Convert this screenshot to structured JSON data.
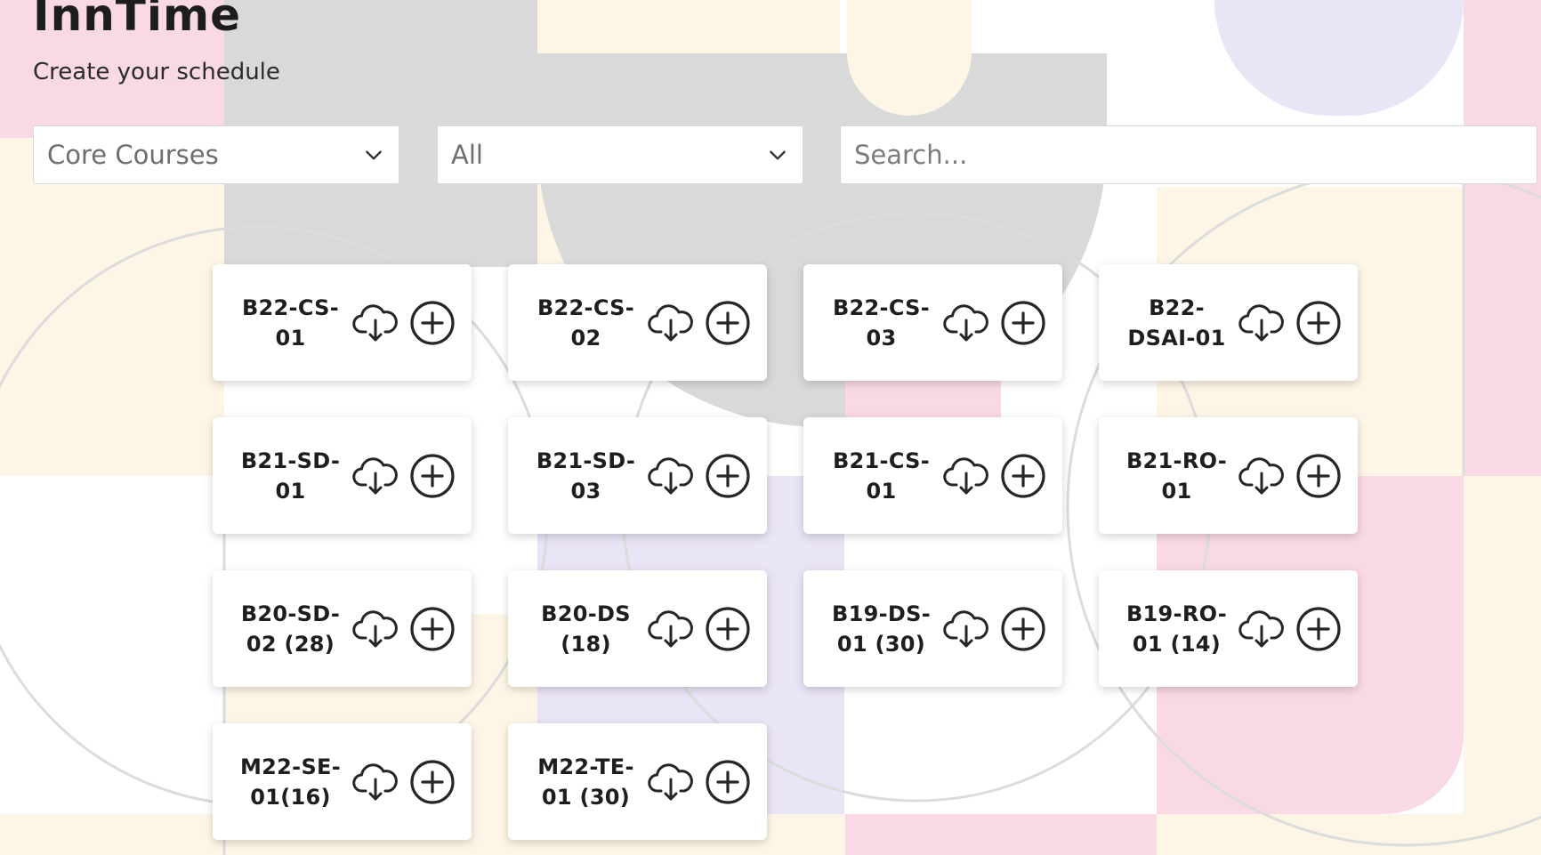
{
  "app": {
    "title": "InnTime",
    "subtitle": "Create your schedule"
  },
  "filters": {
    "category": {
      "value": "Core Courses",
      "icon": "chevron-down-icon"
    },
    "group": {
      "value": "All",
      "icon": "chevron-down-icon"
    },
    "search": {
      "placeholder": "Search...",
      "value": ""
    }
  },
  "courses": [
    {
      "name": "B22-CS-01"
    },
    {
      "name": "B22-CS-02"
    },
    {
      "name": "B22-CS-03"
    },
    {
      "name": "B22-DSAI-01"
    },
    {
      "name": "B21-SD-01"
    },
    {
      "name": "B21-SD-03"
    },
    {
      "name": "B21-CS-01"
    },
    {
      "name": "B21-RO-01"
    },
    {
      "name": "B20-SD-02 (28)"
    },
    {
      "name": "B20-DS (18)"
    },
    {
      "name": "B19-DS-01 (30)"
    },
    {
      "name": "B19-RO-01 (14)"
    },
    {
      "name": "M22-SE-01(16)"
    },
    {
      "name": "M22-TE-01 (30)"
    }
  ],
  "card_icons": {
    "download": "cloud-download-icon",
    "add": "plus-circle-icon"
  },
  "colors": {
    "pink": "#f9d9e3",
    "gray": "#d9d9d9",
    "cream": "#fdf6e6",
    "lavender": "#e9e4f6",
    "text": "#1e1e1e"
  }
}
